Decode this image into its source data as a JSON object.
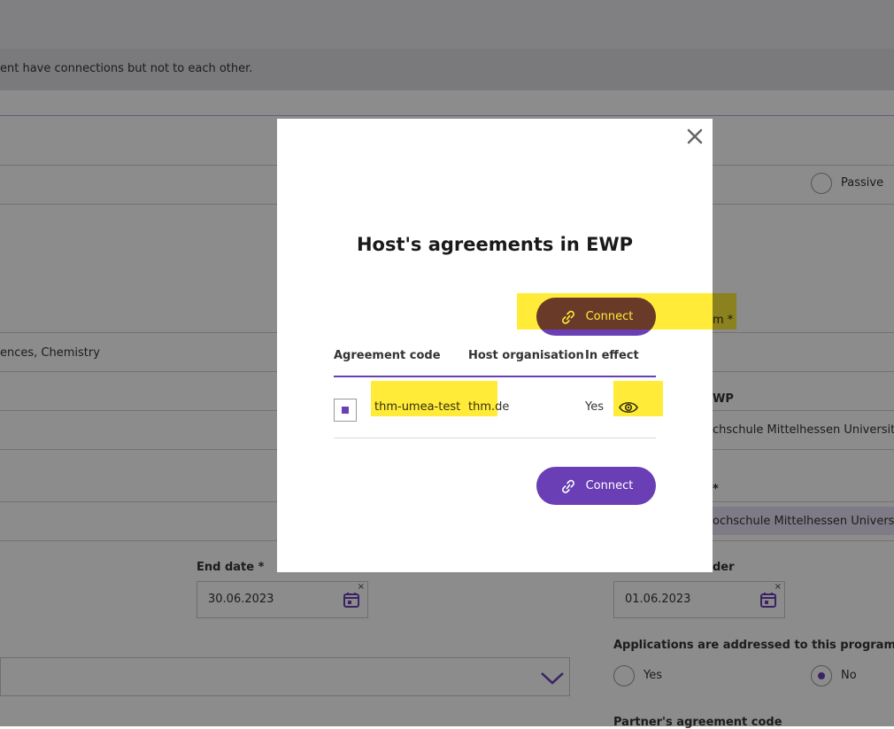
{
  "background": {
    "notice_text": "ent have connections but not to each other.",
    "passive_label": "Passive",
    "field_value_chemistry": "ences, Chemistry",
    "partial_label_m": "m *",
    "partial_label_ewp": "WP",
    "host_value_1": "chschule Mittelhessen University o",
    "partial_star": "*",
    "host_value_2": "ochschule Mittelhessen University",
    "end_date_label": "End date *",
    "end_date_value": "30.06.2023",
    "partial_label_der": "der",
    "deadline_value": "01.06.2023",
    "applications_label": "Applications are addressed to this program",
    "yes_label": "Yes",
    "no_label": "No",
    "partner_code_label": "Partner's agreement code",
    "clear_glyph": "×"
  },
  "modal": {
    "title": "Host's agreements in EWP",
    "connect_label": "Connect",
    "table": {
      "headers": [
        "Agreement code",
        "Host organisation",
        "In effect"
      ],
      "rows": [
        {
          "code": "thm-umea-test",
          "organisation": "thm.de",
          "in_effect": "Yes",
          "selected": true
        }
      ]
    }
  },
  "icons": {
    "close": "close-icon",
    "link": "link-icon",
    "eye": "eye-icon",
    "calendar": "calendar-icon",
    "chevron": "chevron-down-icon"
  },
  "colors": {
    "accent": "#6a3fb5",
    "highlight": "#ffe600"
  }
}
